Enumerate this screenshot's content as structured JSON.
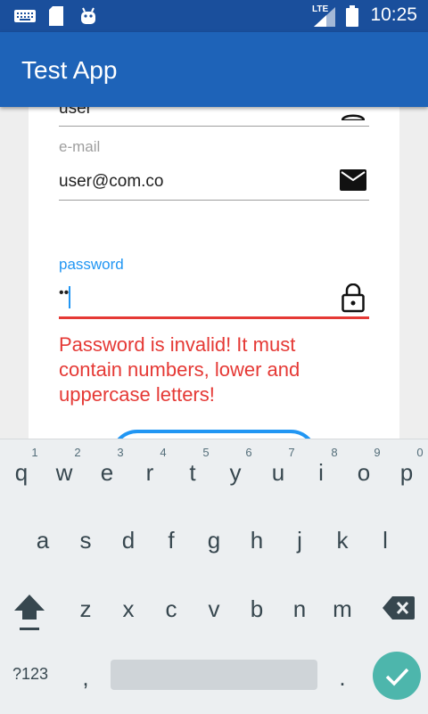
{
  "status_bar": {
    "time": "10:25",
    "network": "LTE",
    "icons": [
      "keyboard-icon",
      "sd-card-icon",
      "android-icon",
      "signal-icon",
      "battery-icon"
    ]
  },
  "app": {
    "title": "Test App"
  },
  "form": {
    "username_value": "user",
    "email_label": "e-mail",
    "email_value": "user@com.co",
    "password_label": "password",
    "password_value": "••",
    "password_error": "Password is invalid! It must contain numbers, lower and uppercase letters!"
  },
  "keyboard": {
    "row1": [
      "q",
      "w",
      "e",
      "r",
      "t",
      "y",
      "u",
      "i",
      "o",
      "p"
    ],
    "row1_hints": [
      "1",
      "2",
      "3",
      "4",
      "5",
      "6",
      "7",
      "8",
      "9",
      "0"
    ],
    "row2": [
      "a",
      "s",
      "d",
      "f",
      "g",
      "h",
      "j",
      "k",
      "l"
    ],
    "row3": [
      "z",
      "x",
      "c",
      "v",
      "b",
      "n",
      "m"
    ],
    "symbols_label": "?123",
    "comma": ",",
    "period": "."
  },
  "colors": {
    "status_bar": "#1a4f9c",
    "app_bar": "#1e63b8",
    "accent": "#2196f3",
    "error": "#e53935",
    "keyboard_bg": "#eceff1",
    "enter_key": "#4db6ac"
  }
}
